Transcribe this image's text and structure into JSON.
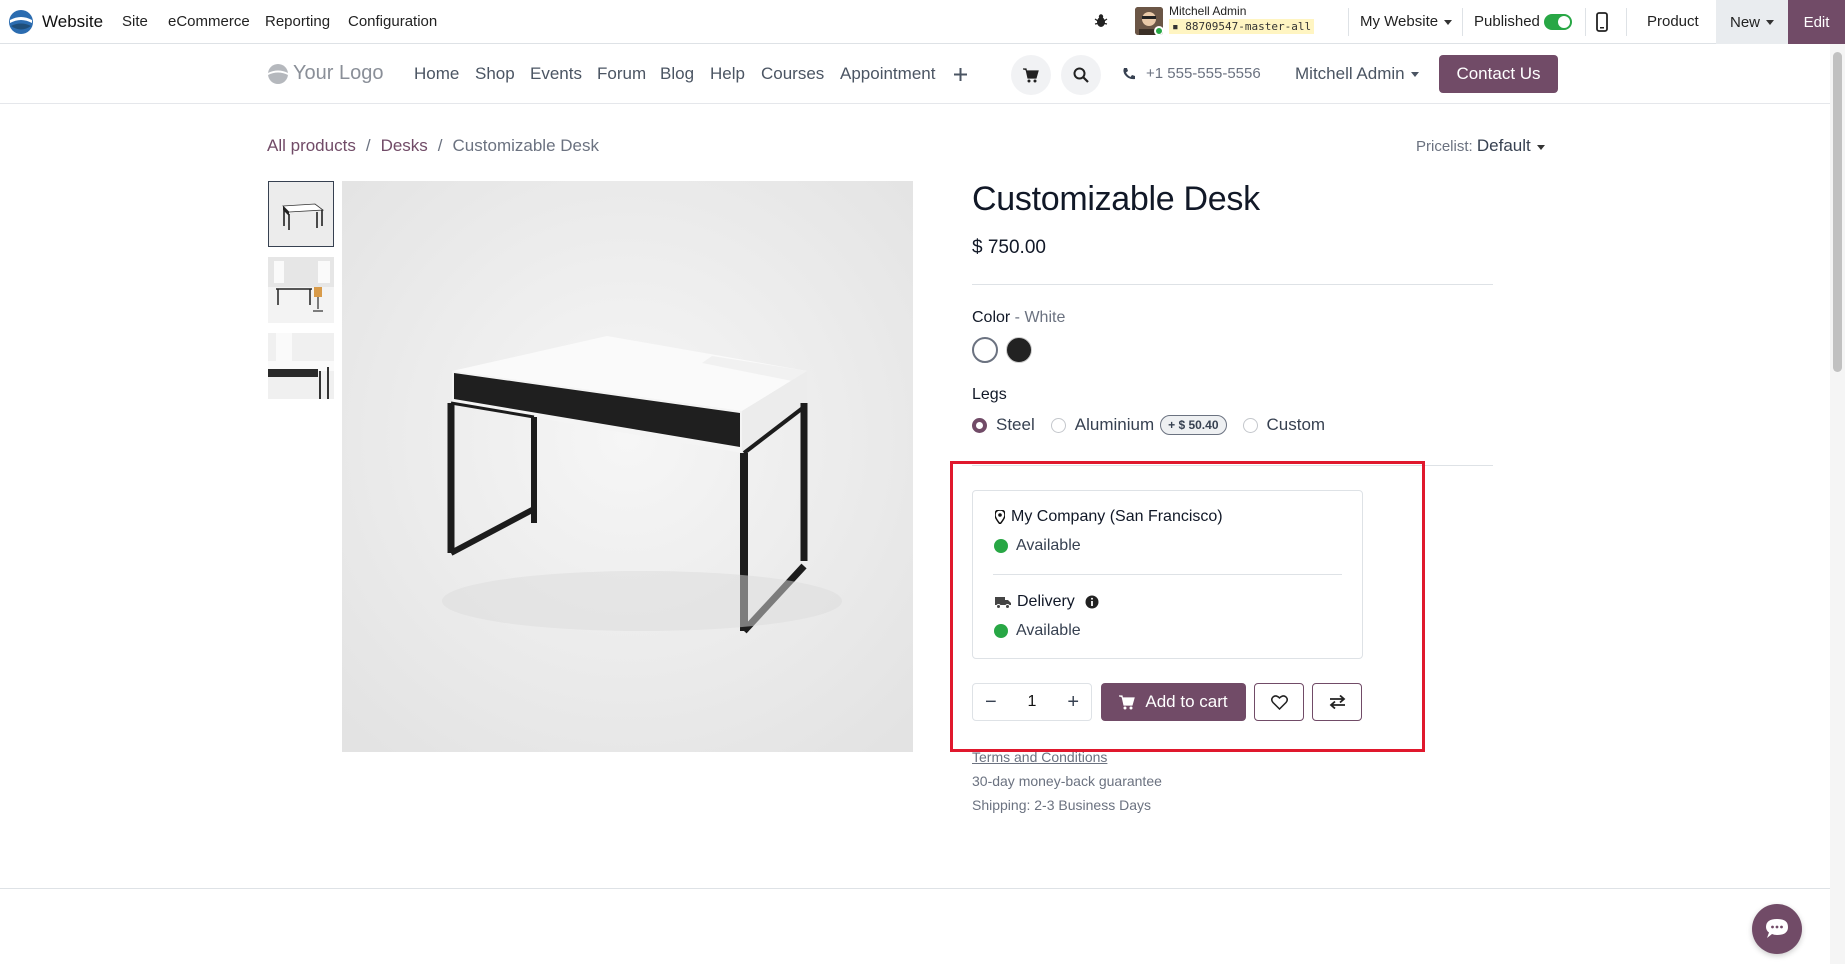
{
  "admin_bar": {
    "app_name": "Website",
    "menus": [
      "Site",
      "eCommerce",
      "Reporting",
      "Configuration"
    ],
    "user_name": "Mitchell Admin",
    "database": "88709547-master-all",
    "website_selector": "My Website",
    "published_label": "Published",
    "product_label": "Product",
    "new_label": "New",
    "edit_label": "Edit"
  },
  "site_header": {
    "logo_text": "Your Logo",
    "nav": [
      "Home",
      "Shop",
      "Events",
      "Forum",
      "Blog",
      "Help",
      "Courses",
      "Appointment"
    ],
    "phone": "+1 555-555-5556",
    "user": "Mitchell Admin",
    "contact_button": "Contact Us"
  },
  "breadcrumb": {
    "items": [
      "All products",
      "Desks",
      "Customizable Desk"
    ],
    "separator": "/"
  },
  "pricelist": {
    "label": "Pricelist:",
    "value": "Default"
  },
  "product": {
    "name": "Customizable Desk",
    "price": "$ 750.00",
    "color_label": "Color",
    "color_separator": " - ",
    "color_value": "White",
    "colors": [
      "#ffffff",
      "#222222"
    ],
    "legs_label": "Legs",
    "legs_options": [
      {
        "label": "Steel",
        "checked": true,
        "extra": ""
      },
      {
        "label": "Aluminium",
        "checked": false,
        "extra": "+ $ 50.40"
      },
      {
        "label": "Custom",
        "checked": false,
        "extra": ""
      }
    ]
  },
  "stock": {
    "warehouse": "My Company (San Francisco)",
    "warehouse_status": "Available",
    "delivery_label": "Delivery",
    "delivery_status": "Available"
  },
  "cart": {
    "quantity": "1",
    "minus": "−",
    "plus": "+",
    "add_to_cart": "Add to cart"
  },
  "notes": {
    "terms": "Terms and Conditions",
    "guarantee": "30-day money-back guarantee",
    "shipping": "Shipping: 2-3 Business Days"
  },
  "colors": {
    "brand": "#714b67",
    "success": "#28a745",
    "highlight": "#e0182d"
  }
}
